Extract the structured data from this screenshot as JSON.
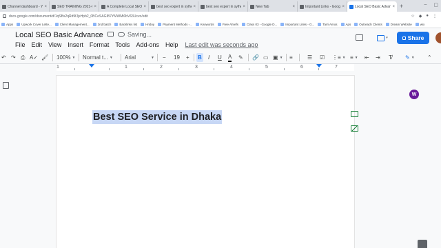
{
  "browser": {
    "tabs": [
      {
        "label": "Channel dashboard - YouT"
      },
      {
        "label": "SEO TRAINING 2021-Corn"
      },
      {
        "label": "A Complete Local SEO Ch"
      },
      {
        "label": "best seo expert in sylhet"
      },
      {
        "label": "best seo expert in sylhet"
      },
      {
        "label": "New Tab"
      },
      {
        "label": "Important Links - Google"
      },
      {
        "label": "Local SEO Basic Advance"
      }
    ],
    "active_tab": 7,
    "new_tab_symbol": "+",
    "url": "docs.google.com/document/d/1qSBs2qRd9fJjsHpb2_0BCeSAGIB7YMWMi0bV63Ucvo/edit",
    "bookmarks": [
      {
        "label": "Apps"
      },
      {
        "label": "Upwork Cover Lette..."
      },
      {
        "label": "Client Management..."
      },
      {
        "label": "2nd batch"
      },
      {
        "label": "Backlinks list"
      },
      {
        "label": "Hridoy"
      },
      {
        "label": "Payment Methods -..."
      },
      {
        "label": "Keywords"
      },
      {
        "label": "Free Ahrefs"
      },
      {
        "label": "Class 03 - Google D..."
      },
      {
        "label": "Important Links - G..."
      },
      {
        "label": "Tarri Amos"
      },
      {
        "label": "Aps"
      },
      {
        "label": "Outreach Clients"
      },
      {
        "label": "Dream Website"
      },
      {
        "label": "wix"
      }
    ]
  },
  "doc": {
    "title": "Local SEO Basic Advance",
    "status": "Saving...",
    "menus": [
      "File",
      "Edit",
      "View",
      "Insert",
      "Format",
      "Tools",
      "Add-ons",
      "Help"
    ],
    "last_edit": "Last edit was seconds ago",
    "share_label": "Share"
  },
  "toolbar": {
    "zoom": "100%",
    "style": "Normal t...",
    "font": "Arial",
    "font_size": "19",
    "minus": "−",
    "plus": "+",
    "bold": "B",
    "italic": "I",
    "underline": "U",
    "text_color": "A"
  },
  "ruler": {
    "numbers": [
      "1",
      "1",
      "2",
      "3",
      "4",
      "5",
      "6",
      "7"
    ]
  },
  "content": {
    "heading": "Best SEO Service in Dhaka",
    "highlight_color": "#c7d7f5"
  },
  "extension_badge": "W",
  "colors": {
    "accent": "#1a73e8",
    "comment_green": "#188038",
    "selection": "#c7d7f5"
  }
}
